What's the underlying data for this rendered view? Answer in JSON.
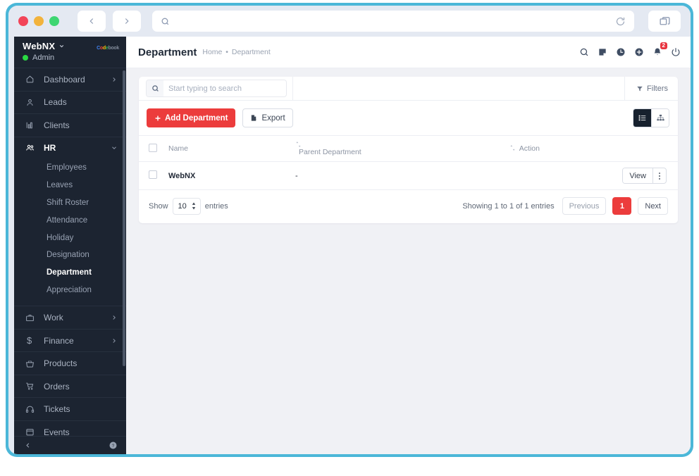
{
  "browser": {
    "traffic_lights": [
      "close",
      "minimize",
      "maximize"
    ],
    "back_icon": "chevron-left-icon",
    "forward_icon": "chevron-right-icon",
    "url_value": "",
    "reload_icon": "reload-icon",
    "tabs_icon": "tabs-icon"
  },
  "sidebar": {
    "brand": "WebNX",
    "role": "Admin",
    "logo_parts": [
      "C",
      "o",
      "d",
      "e",
      "book"
    ],
    "items": [
      {
        "label": "Dashboard",
        "icon": "home-icon",
        "arrow": "chevron-right-icon",
        "state": "collapsed"
      },
      {
        "label": "Leads",
        "icon": "user-icon",
        "arrow": "",
        "state": "plain"
      },
      {
        "label": "Clients",
        "icon": "chart-icon",
        "arrow": "",
        "state": "plain"
      },
      {
        "label": "HR",
        "icon": "people-icon",
        "arrow": "chevron-down-icon",
        "state": "open"
      },
      {
        "label": "Work",
        "icon": "briefcase-icon",
        "arrow": "chevron-right-icon",
        "state": "collapsed"
      },
      {
        "label": "Finance",
        "icon": "dollar-icon",
        "arrow": "chevron-right-icon",
        "state": "collapsed"
      },
      {
        "label": "Products",
        "icon": "basket-icon",
        "arrow": "",
        "state": "plain"
      },
      {
        "label": "Orders",
        "icon": "cart-icon",
        "arrow": "",
        "state": "plain"
      },
      {
        "label": "Tickets",
        "icon": "headset-icon",
        "arrow": "",
        "state": "plain"
      },
      {
        "label": "Events",
        "icon": "calendar-icon",
        "arrow": "",
        "state": "plain"
      }
    ],
    "hr_subitems": [
      {
        "label": "Employees",
        "active": false
      },
      {
        "label": "Leaves",
        "active": false
      },
      {
        "label": "Shift Roster",
        "active": false
      },
      {
        "label": "Attendance",
        "active": false
      },
      {
        "label": "Holiday",
        "active": false
      },
      {
        "label": "Designation",
        "active": false
      },
      {
        "label": "Department",
        "active": true
      },
      {
        "label": "Appreciation",
        "active": false
      }
    ],
    "footer": {
      "collapse_icon": "chevron-left-icon",
      "help_icon": "help-circle-icon"
    }
  },
  "header": {
    "title": "Department",
    "breadcrumb": {
      "home": "Home",
      "separator": "•",
      "current": "Department"
    },
    "icons": [
      {
        "name": "search-icon"
      },
      {
        "name": "note-icon"
      },
      {
        "name": "clock-icon"
      },
      {
        "name": "plus-circle-icon"
      },
      {
        "name": "bell-icon",
        "badge": "2"
      },
      {
        "name": "power-icon"
      }
    ],
    "badge_color": "#e8343f"
  },
  "toolbar": {
    "search_placeholder": "Start typing to search",
    "search_value": "",
    "search_icon": "search-icon",
    "filters_label": "Filters",
    "filters_icon": "funnel-icon",
    "add_label": "Add Department",
    "add_icon": "plus-icon",
    "export_label": "Export",
    "export_icon": "export-icon",
    "view_list_icon": "list-view-icon",
    "view_chart_icon": "org-chart-icon",
    "active_view": "list"
  },
  "table": {
    "columns": [
      {
        "key": "check",
        "label": ""
      },
      {
        "key": "name",
        "label": "Name",
        "sortable": true,
        "sort_icon": "sort-icon"
      },
      {
        "key": "parent",
        "label": "Parent Department",
        "sortable": true,
        "sort_icon": "sort-icon"
      },
      {
        "key": "action",
        "label": "Action",
        "sortable": false
      }
    ],
    "rows": [
      {
        "name": "WebNX",
        "parent": "-",
        "view_label": "View",
        "more_icon": "vertical-dots-icon"
      }
    ]
  },
  "footer": {
    "show_label": "Show",
    "entries_value": "10",
    "entries_label": "entries",
    "showing_text": "Showing 1 to 1 of 1 entries",
    "previous_label": "Previous",
    "next_label": "Next",
    "current_page": "1"
  },
  "colors": {
    "accent": "#ec3c3c",
    "sidebar": "#1c2431",
    "page_bg": "#f0f1f5",
    "browser_frame": "#4bb7d8"
  }
}
